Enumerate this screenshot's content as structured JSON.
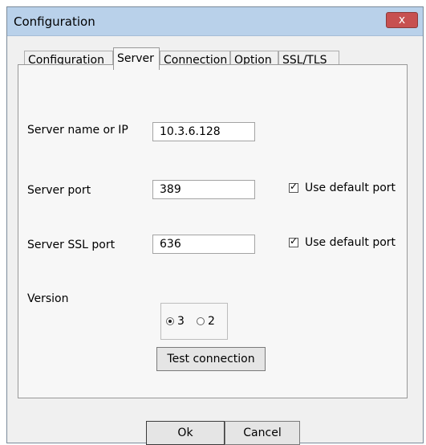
{
  "window": {
    "title": "Configuration",
    "close_glyph": "x"
  },
  "tabs": [
    {
      "label": "Configuration",
      "active": false
    },
    {
      "label": "Server",
      "active": true
    },
    {
      "label": "Connection",
      "active": false
    },
    {
      "label": "Option",
      "active": false
    },
    {
      "label": "SSL/TLS",
      "active": false
    }
  ],
  "server": {
    "name_label": "Server name or IP",
    "name_value": "10.3.6.128",
    "port_label": "Server port",
    "port_value": "389",
    "port_default_label": "Use default port",
    "port_default_checked": true,
    "ssl_port_label": "Server SSL port",
    "ssl_port_value": "636",
    "ssl_port_default_label": "Use default port",
    "ssl_port_default_checked": true,
    "version_label": "Version",
    "version_options": [
      "3",
      "2"
    ],
    "version_selected": "3",
    "test_button": "Test connection"
  },
  "footer": {
    "ok_label": "Ok",
    "cancel_label": "Cancel"
  }
}
